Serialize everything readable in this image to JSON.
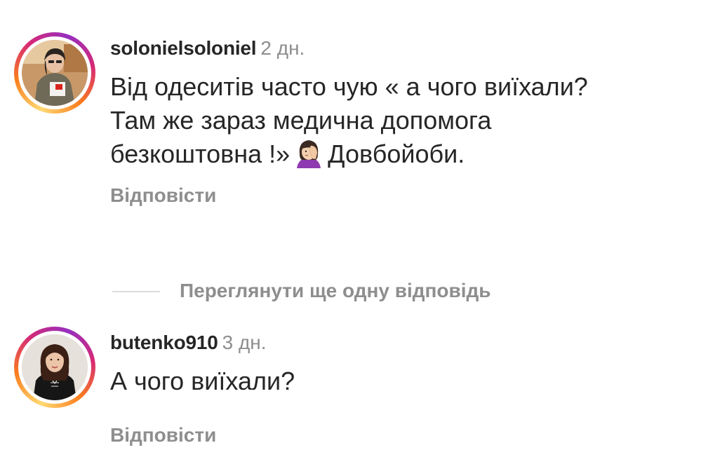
{
  "comments": [
    {
      "username": "solonielsoloniel",
      "time": "2 дн.",
      "text_before_emoji": "Від одеситів часто чую « а чого виїхали?\nТам же зараз медична допомога\nбезкоштовна !»",
      "emoji_icon": "woman-facepalming-emoji",
      "text_after_emoji": "Довбойоби.",
      "reply_label": "Відповісти"
    },
    {
      "username": "butenko910",
      "time": "3 дн.",
      "text": "А чого виїхали?",
      "reply_label": "Відповісти"
    }
  ],
  "more_replies_label": "Переглянути ще одну відповідь",
  "colors": {
    "text": "#262626",
    "secondary": "#8e8e8e",
    "divider": "#dbdbdb",
    "story_ring": [
      "#feda75",
      "#fa7e1e",
      "#d62976",
      "#962fbf"
    ]
  }
}
